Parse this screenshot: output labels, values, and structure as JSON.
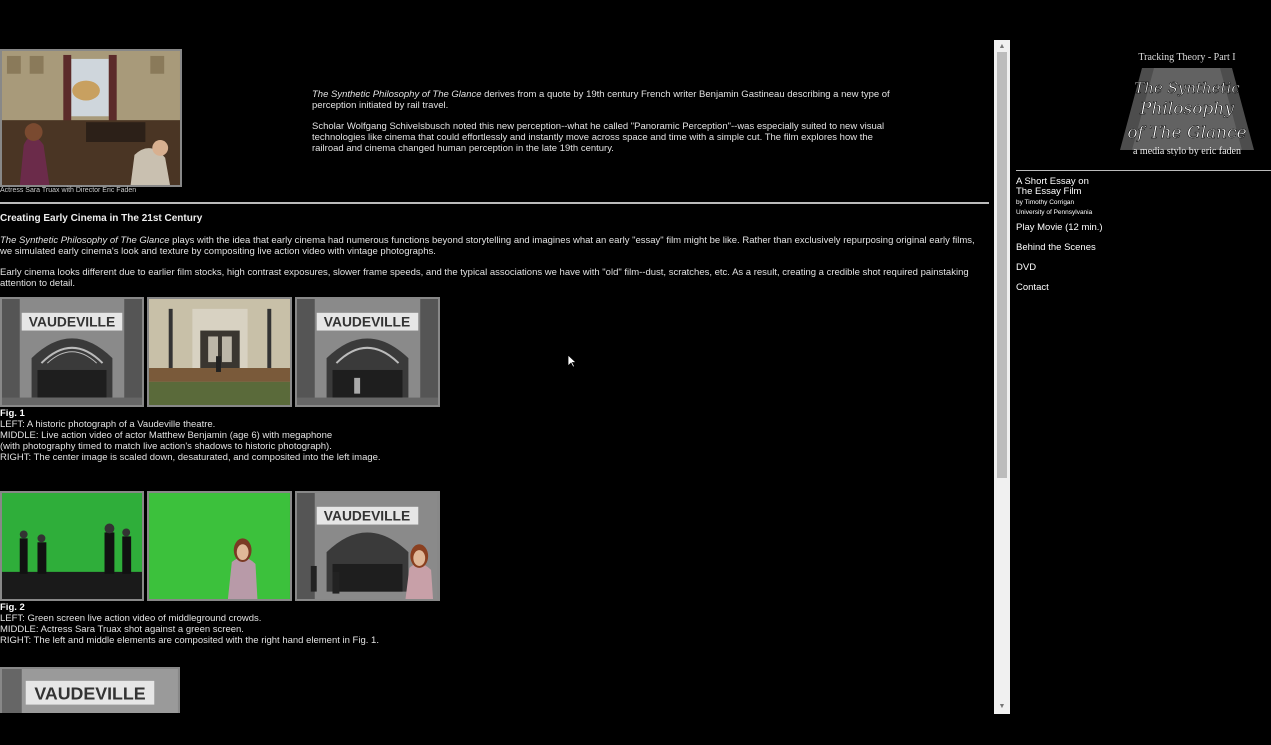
{
  "intro": {
    "photo_caption": "Actress Sara Truax with Director Eric Faden",
    "p1_title": "The Synthetic Philosophy of The Glance",
    "p1_rest": " derives from a quote by 19th century French writer Benjamin Gastineau describing a new type of perception initiated by rail travel.",
    "p2": "Scholar Wolfgang Schivelsbusch noted this new perception--what he called \"Panoramic Perception\"--was especially suited to new visual technologies like cinema that could effortlessly and instantly move across space and time with a simple cut. The film explores how the railroad and cinema changed human perception in the late 19th century."
  },
  "section": {
    "heading": "Creating Early Cinema in The 21st Century",
    "p1_title": "The Synthetic Philosophy of The Glance",
    "p1_rest": " plays with the idea that early cinema had numerous functions beyond storytelling and imagines what an early \"essay\" film might be like. Rather than exclusively repurposing original early films, we simulated early cinema's look and texture by compositing live action video with vintage photographs.",
    "p2": "Early cinema looks different due to earlier film stocks, high contrast exposures, slower frame speeds, and the typical associations we have with \"old\" film--dust, scratches, etc. As a result, creating a credible shot required painstaking attention to detail."
  },
  "figures": [
    {
      "label": "Fig. 1",
      "lines": [
        "LEFT: A historic photograph of a Vaudeville theatre.",
        "MIDDLE: Live action video of actor Matthew Benjamin (age 6) with megaphone",
        "(with photography timed to match live action's shadows to historic photograph).",
        "RIGHT: The center image is scaled down, desaturated, and composited into the left image."
      ]
    },
    {
      "label": "Fig. 2",
      "lines": [
        "LEFT: Green screen live action video of middleground crowds.",
        "MIDDLE: Actress Sara Truax shot against a green screen.",
        "RIGHT: The left and middle elements are composited with the right hand element in Fig. 1."
      ]
    }
  ],
  "theatre_sign": "VAUDEVILLE",
  "sidebar": {
    "logo_top": "Tracking Theory - Part I",
    "logo_line1": "The Synthetic",
    "logo_line2": "Philosophy",
    "logo_line3": "of The Glance",
    "logo_sub": "a media stylo by eric faden",
    "essay_line1": "A Short Essay on",
    "essay_line2": "The Essay Film",
    "essay_by": "by Timothy Corrigan",
    "essay_affil": "University of Pennsylvania",
    "nav": [
      "Play Movie (12 min.)",
      "Behind the Scenes",
      "DVD",
      "Contact"
    ]
  },
  "colors": {
    "background": "#000000",
    "text": "#e2e2e2",
    "green_screen": "#3bbf3b"
  }
}
